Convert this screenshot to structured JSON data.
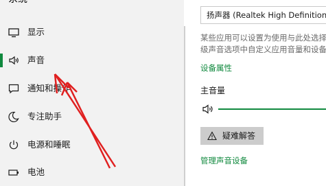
{
  "sidebar": {
    "title": "系统",
    "items": [
      {
        "label": "显示",
        "icon": "monitor-icon",
        "active": false
      },
      {
        "label": "声音",
        "icon": "speaker-icon",
        "active": true
      },
      {
        "label": "通知和操作",
        "icon": "message-icon",
        "active": false
      },
      {
        "label": "专注助手",
        "icon": "moon-icon",
        "active": false
      },
      {
        "label": "电源和睡眠",
        "icon": "power-icon",
        "active": false
      },
      {
        "label": "电池",
        "icon": "battery-icon",
        "active": false
      }
    ]
  },
  "pane": {
    "output_device_value": "扬声器 (Realtek High Definition Audio)",
    "description_line1": "某些应用可以设置为使用与此处选择",
    "description_line2": "级声音选项中自定义应用音量和设备",
    "device_properties_link": "设备属性",
    "master_volume_label": "主音量",
    "troubleshoot_label": "疑难解答",
    "manage_devices_link": "管理声音设备"
  },
  "colors": {
    "accent": "#10893e",
    "sidebar_bg": "#f2f2f2",
    "annotation": "#e02020"
  }
}
